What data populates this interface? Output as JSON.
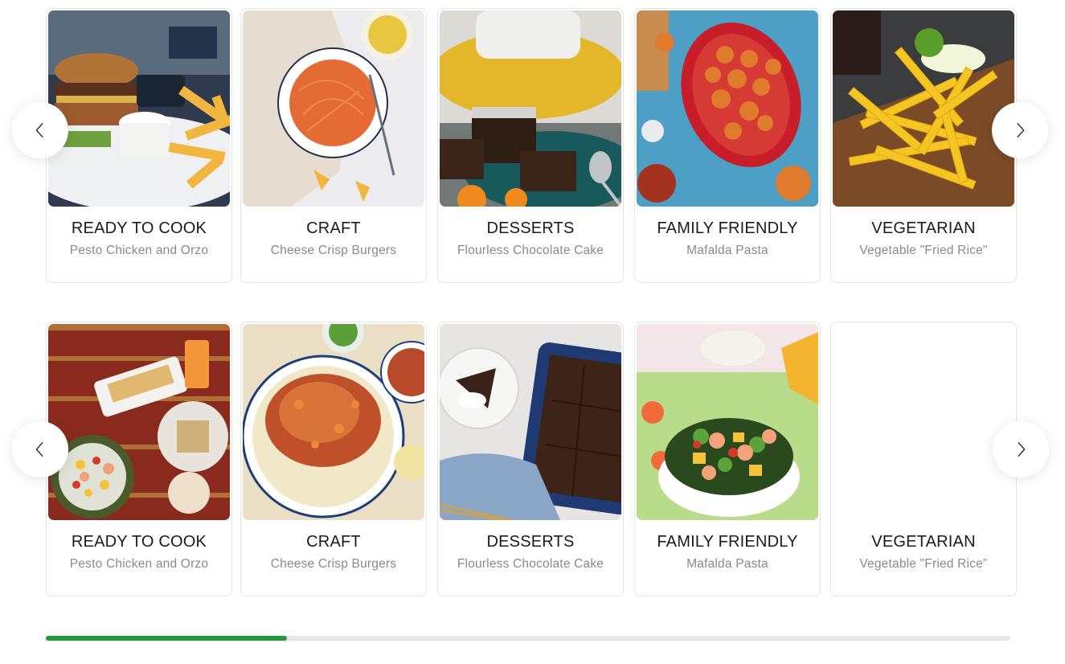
{
  "rows": [
    {
      "cards": [
        {
          "title": "READY TO COOK",
          "subtitle": "Pesto Chicken and Orzo",
          "image": "burger-fries-photo"
        },
        {
          "title": "CRAFT",
          "subtitle": "Cheese Crisp Burgers",
          "image": "spaghetti-photo"
        },
        {
          "title": "DESSERTS",
          "subtitle": "Flourless Chocolate Cake",
          "image": "brownies-photo"
        },
        {
          "title": "FAMILY FRIENDLY",
          "subtitle": "Mafalda Pasta",
          "image": "shrimp-basket-photo"
        },
        {
          "title": "VEGETARIAN",
          "subtitle": "Vegetable \"Fried Rice\"",
          "image": "french-fries-photo"
        }
      ]
    },
    {
      "cards": [
        {
          "title": "READY TO COOK",
          "subtitle": "Pesto Chicken and Orzo",
          "image": "tacos-salad-photo"
        },
        {
          "title": "CRAFT",
          "subtitle": "Cheese Crisp Burgers",
          "image": "fish-stew-photo"
        },
        {
          "title": "DESSERTS",
          "subtitle": "Flourless Chocolate Cake",
          "image": "brownie-tray-photo"
        },
        {
          "title": "FAMILY FRIENDLY",
          "subtitle": "Mafalda Pasta",
          "image": "shrimp-salad-photo"
        },
        {
          "title": "VEGETARIAN",
          "subtitle": "Vegetable \"Fried Rice\"",
          "image": "blank-photo"
        }
      ]
    }
  ],
  "carousel": {
    "prev_icon": "chevron-left-icon",
    "next_icon": "chevron-right-icon"
  },
  "progress": {
    "fraction": 0.25,
    "color": "#1f9a3a",
    "track_color": "#e6e6e6"
  }
}
